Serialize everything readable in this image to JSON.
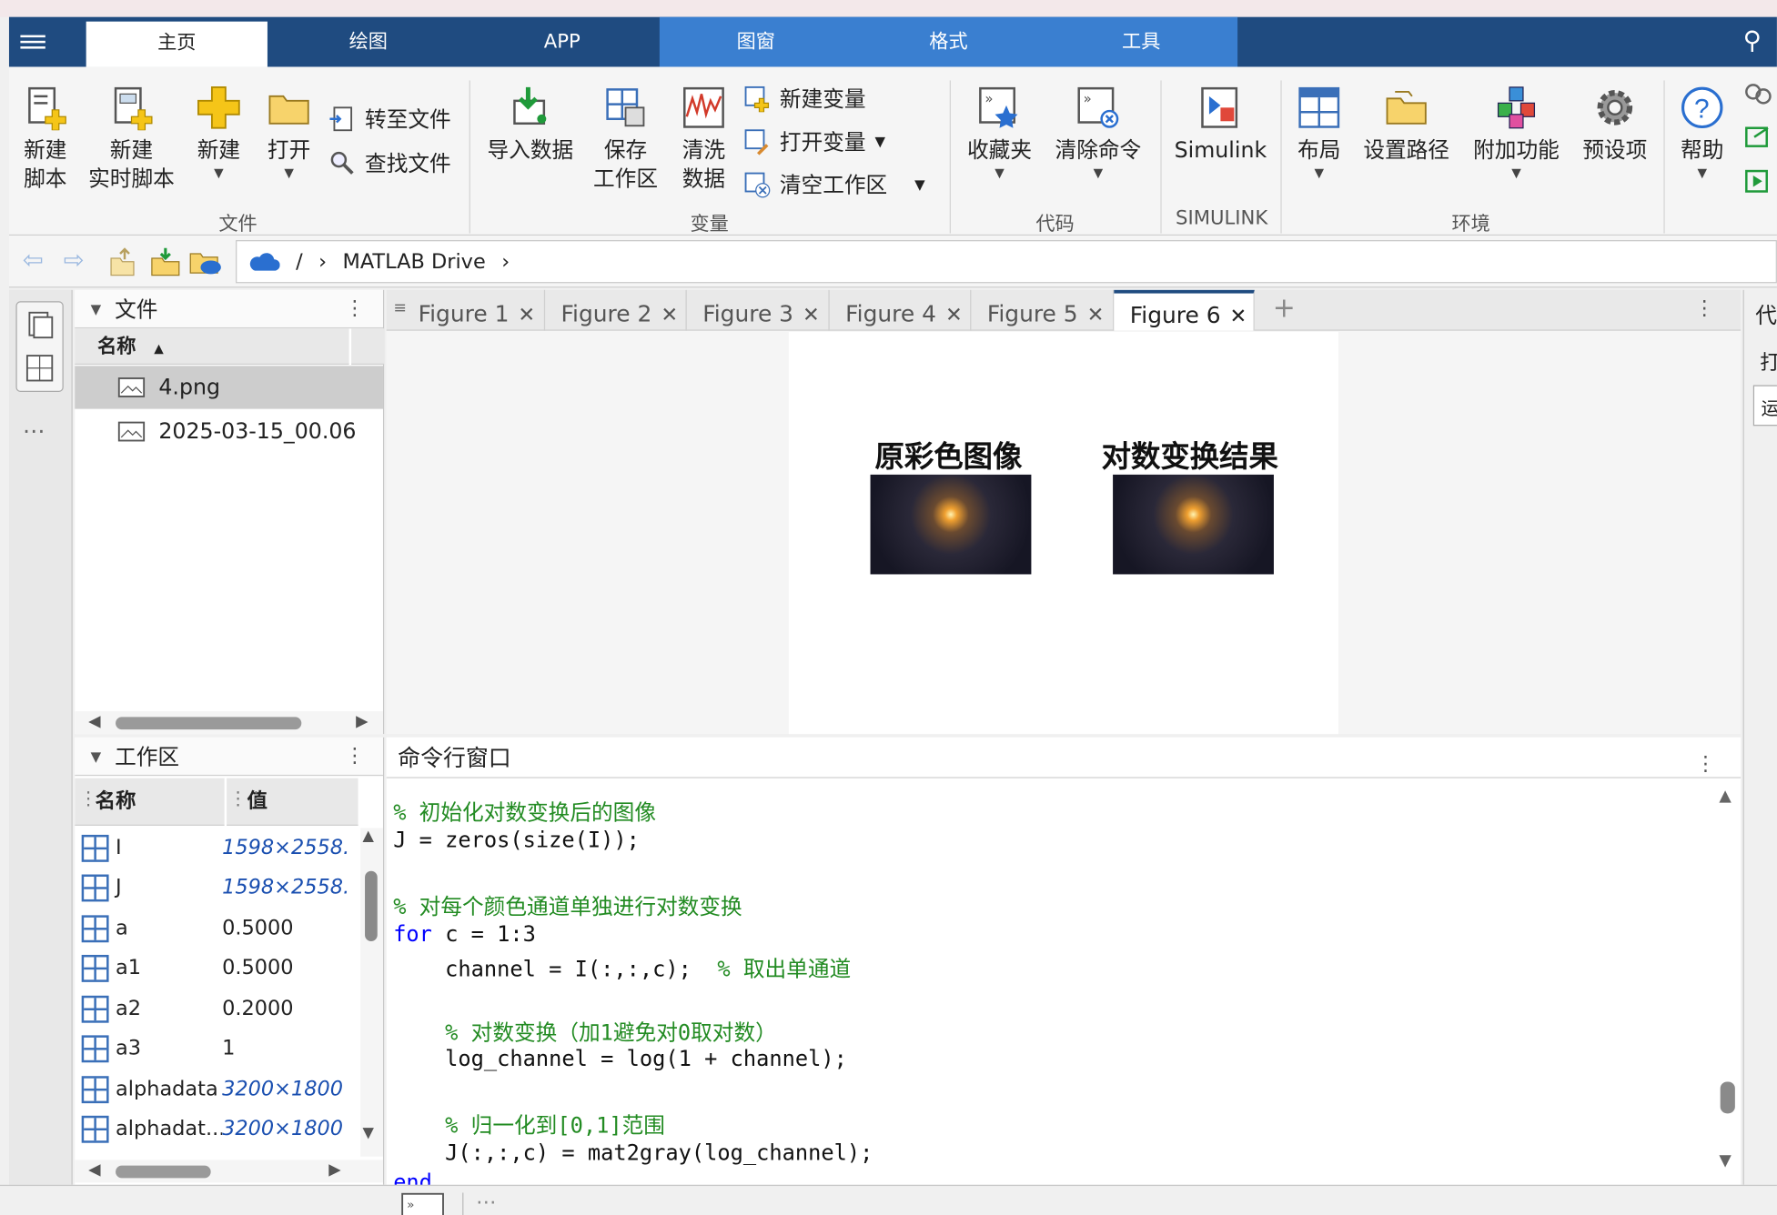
{
  "tabs": [
    {
      "label": "主页",
      "active": true
    },
    {
      "label": "绘图"
    },
    {
      "label": "APP"
    },
    {
      "label": "图窗"
    },
    {
      "label": "格式"
    },
    {
      "label": "工具"
    }
  ],
  "ribbon": {
    "new_script_1": "新建",
    "new_script_2": "脚本",
    "new_live_1": "新建",
    "new_live_2": "实时脚本",
    "new": "新建",
    "open": "打开",
    "goto_file": "转至文件",
    "find_file": "查找文件",
    "section_file": "文件",
    "import_data": "导入数据",
    "save_ws_1": "保存",
    "save_ws_2": "工作区",
    "clean_1": "清洗",
    "clean_2": "数据",
    "new_var": "新建变量",
    "open_var": "打开变量",
    "clear_ws": "清空工作区",
    "section_var": "变量",
    "favorites": "收藏夹",
    "clear_cmds": "清除命令",
    "section_code": "代码",
    "simulink": "Simulink",
    "section_simulink": "SIMULINK",
    "layout": "布局",
    "set_path": "设置路径",
    "addons": "附加功能",
    "prefs": "预设项",
    "section_env": "环境",
    "help": "帮助"
  },
  "address": {
    "root": "/",
    "folder": "MATLAB Drive"
  },
  "files": {
    "title": "文件",
    "col_name": "名称",
    "items": [
      {
        "name": "4.png",
        "selected": true
      },
      {
        "name": "2025-03-15_00.06"
      }
    ]
  },
  "workspace": {
    "title": "工作区",
    "col_name": "名称",
    "col_value": "值",
    "vars": [
      {
        "name": "I",
        "value": "1598×2558...",
        "italic": true
      },
      {
        "name": "J",
        "value": "1598×2558...",
        "italic": true
      },
      {
        "name": "a",
        "value": "0.5000"
      },
      {
        "name": "a1",
        "value": "0.5000"
      },
      {
        "name": "a2",
        "value": "0.2000"
      },
      {
        "name": "a3",
        "value": "1"
      },
      {
        "name": "alphadata",
        "value": "3200×1800 ...",
        "italic": true
      },
      {
        "name": "alphadat...",
        "value": "3200×1800 ...",
        "italic": true
      }
    ]
  },
  "figure_tabs": [
    "Figure 1",
    "Figure 2",
    "Figure 3",
    "Figure 4",
    "Figure 5",
    "Figure 6"
  ],
  "active_figure": "Figure 6",
  "figure": {
    "left_title": "原彩色图像",
    "right_title": "对数变换结果"
  },
  "command": {
    "title": "命令行窗口",
    "lines": [
      {
        "text": "% 初始化对数变换后的图像",
        "kind": "comment"
      },
      {
        "text": "J = zeros(size(I));",
        "kind": "code"
      },
      {
        "text": "",
        "kind": "code"
      },
      {
        "text": "% 对每个颜色通道单独进行对数变换",
        "kind": "comment"
      },
      {
        "text": "for",
        "kind": "keyword",
        "rest": " c = 1:3"
      },
      {
        "text": "    channel = I(:,:,c);  ",
        "kind": "code",
        "comment": "% 取出单通道"
      },
      {
        "text": "",
        "kind": "code"
      },
      {
        "text": "    % 对数变换（加1避免对0取对数）",
        "kind": "comment"
      },
      {
        "text": "    log_channel = log(1 + channel);",
        "kind": "code"
      },
      {
        "text": "",
        "kind": "code"
      },
      {
        "text": "    % 归一化到[0,1]范围",
        "kind": "comment"
      },
      {
        "text": "    J(:,:,c) = mat2gray(log_channel);",
        "kind": "code"
      },
      {
        "text": "end",
        "kind": "keyword"
      }
    ]
  },
  "right_panel": {
    "title": "代",
    "item": "打",
    "box": "运"
  }
}
